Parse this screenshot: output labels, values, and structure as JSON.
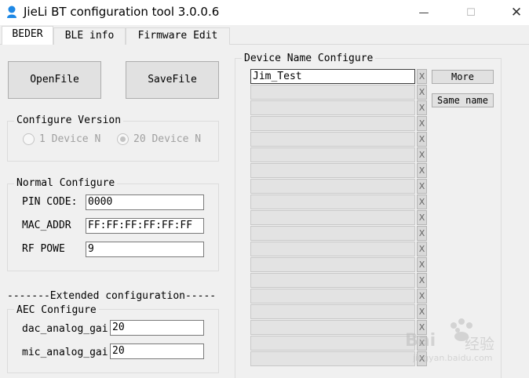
{
  "window": {
    "title": "JieLi BT configuration tool 3.0.0.6",
    "minimize_glyph": "—",
    "maximize_glyph": "☐",
    "close_glyph": "✕"
  },
  "tabs": [
    {
      "label": "BEDER",
      "active": true
    },
    {
      "label": "BLE info",
      "active": false
    },
    {
      "label": "Firmware Edit",
      "active": false
    }
  ],
  "buttons": {
    "open_file": "OpenFile",
    "save_file": "SaveFile",
    "more": "More",
    "same_name": "Same name"
  },
  "configure_version": {
    "legend": "Configure Version",
    "options": [
      {
        "label": "1 Device N",
        "checked": false,
        "disabled": true
      },
      {
        "label": "20 Device N",
        "checked": true,
        "disabled": true
      }
    ]
  },
  "normal_configure": {
    "legend": "Normal Configure",
    "pin_label": "PIN CODE:",
    "pin_value": "0000",
    "mac_label": "MAC_ADDR",
    "mac_value": "FF:FF:FF:FF:FF:FF",
    "rf_label": "RF POWE",
    "rf_value": "9"
  },
  "extended": {
    "divider": "-------Extended configuration-----",
    "aec_legend": "AEC Configure",
    "dac_label": "dac_analog_gai",
    "dac_value": "20",
    "mic_label": "mic_analog_gai",
    "mic_value": "20"
  },
  "device_names": {
    "legend": "Device Name Configure",
    "clear_glyph": "X",
    "entries": [
      "Jim_Test",
      "",
      "",
      "",
      "",
      "",
      "",
      "",
      "",
      "",
      "",
      "",
      "",
      "",
      "",
      "",
      "",
      "",
      "",
      ""
    ]
  },
  "watermark": {
    "brand": "Bai",
    "suffix": "经验",
    "url": "jingyan.baidu.com"
  },
  "colors": {
    "background": "#f0f0f0",
    "titlebar": "#ffffff",
    "app_icon": "#1e88e5",
    "disabled_text": "#a0a0a0"
  }
}
